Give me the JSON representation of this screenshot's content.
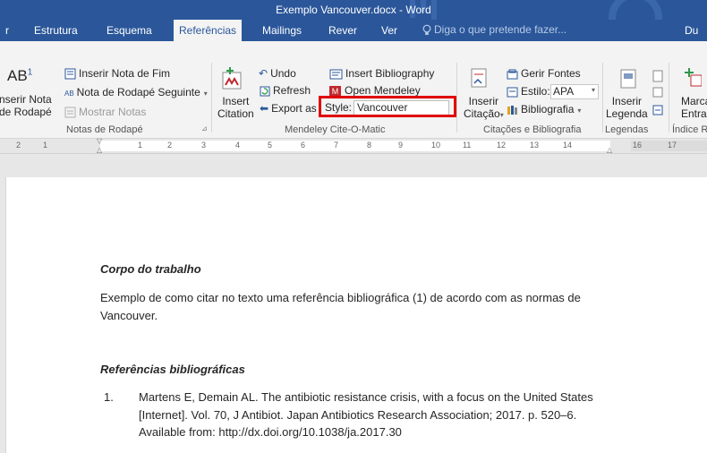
{
  "window": {
    "title": "Exemplo Vancouver.docx - Word"
  },
  "tabs": [
    {
      "label": "r"
    },
    {
      "label": "Estrutura"
    },
    {
      "label": "Esquema"
    },
    {
      "label": "Referências"
    },
    {
      "label": "Mailings"
    },
    {
      "label": "Rever"
    },
    {
      "label": "Ver"
    },
    {
      "label": "Du"
    }
  ],
  "tell_me": "Diga o que pretende fazer...",
  "ribbon": {
    "footnotes": {
      "insert_footnote_big_icon": "AB",
      "insert_footnote_big_sup": "1",
      "insert_footnote_line1": "nserir Nota",
      "insert_footnote_line2": "de Rodapé",
      "insert_endnote": "Inserir Nota de Fim",
      "next_footnote": "Nota de Rodapé Seguinte",
      "show_notes": "Mostrar Notas",
      "group": "Notas de Rodapé"
    },
    "mendeley": {
      "insert_citation_line1": "Insert",
      "insert_citation_line2": "Citation",
      "undo": "Undo",
      "refresh": "Refresh",
      "export_as": "Export as",
      "insert_bibliography": "Insert Bibliography",
      "open_mendeley": "Open Mendeley",
      "style_label": "Style:",
      "style_value": "Vancouver",
      "group": "Mendeley Cite-O-Matic"
    },
    "citations": {
      "insert_citation_line1": "Inserir",
      "insert_citation_line2": "Citação",
      "manage_sources": "Gerir Fontes",
      "style_label": "Estilo:",
      "style_value": "APA",
      "bibliography": "Bibliografia",
      "group": "Citações e Bibliografia"
    },
    "captions": {
      "insert_caption_line1": "Inserir",
      "insert_caption_line2": "Legenda",
      "group": "Legendas"
    },
    "index": {
      "mark_entry_line1": "Marca",
      "mark_entry_line2": "Entrad",
      "group": "Índice R"
    }
  },
  "ruler": {
    "ticks": [
      "2",
      "1",
      "1",
      "2",
      "3",
      "4",
      "5",
      "6",
      "7",
      "8",
      "9",
      "10",
      "11",
      "12",
      "13",
      "14",
      "16",
      "17"
    ]
  },
  "document": {
    "heading1": "Corpo do trabalho",
    "para_line1": "Exemplo de como citar no texto uma referência bibliográfica (1) de acordo com as normas de",
    "para_line2": "Vancouver.",
    "heading2": "Referências bibliográficas",
    "ref_number": "1.",
    "ref_line1": "Martens E, Demain AL. The antibiotic resistance crisis, with a focus on the United States",
    "ref_line2": "[Internet]. Vol. 70, J Antibiot. Japan Antibiotics Research Association; 2017. p. 520–6.",
    "ref_line3": "Available from: http://dx.doi.org/10.1038/ja.2017.30"
  },
  "colors": {
    "word_blue": "#2b579a",
    "highlight_red": "#e00000",
    "mendeley_red": "#c0282e"
  }
}
